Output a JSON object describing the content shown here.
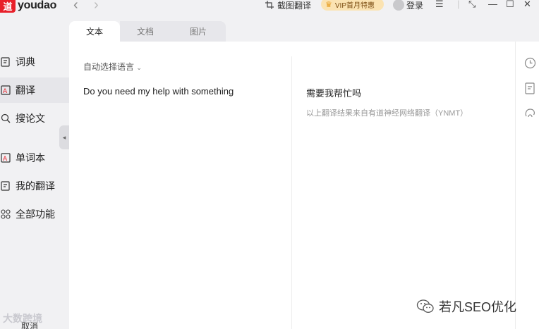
{
  "app": {
    "logo_mark": "道",
    "logo_text": "youdao",
    "nav_back": "‹",
    "nav_forward": "›",
    "screenshot_translate": "截图翻译",
    "vip_promo": "VIP首月特惠",
    "login": "登录",
    "menu": "☰",
    "shrink": "⤡",
    "minimize": "—",
    "maximize": "☐",
    "close": "✕"
  },
  "sidebar": {
    "items": [
      {
        "label": "词典",
        "icon": "dictionary-icon"
      },
      {
        "label": "翻译",
        "icon": "translate-icon"
      },
      {
        "label": "搜论文",
        "icon": "paper-search-icon"
      },
      {
        "label": "单词本",
        "icon": "wordbook-icon"
      },
      {
        "label": "我的翻译",
        "icon": "my-translation-icon"
      },
      {
        "label": "全部功能",
        "icon": "all-features-icon"
      }
    ],
    "collapse": "◂",
    "cancel": "取消"
  },
  "tabs": [
    {
      "label": "文本"
    },
    {
      "label": "文档"
    },
    {
      "label": "图片"
    }
  ],
  "translate": {
    "language_select": "自动选择语言",
    "source_text": "Do you need my help with something",
    "output_text": "需要我帮忙吗",
    "engine_note": "以上翻译结果来自有道神经网络翻译（YNMT）"
  },
  "watermarks": {
    "left": "大数跨境",
    "right": "若凡SEO优化"
  },
  "colors": {
    "brand": "#e8202a",
    "vip_bg": "#fbe3b2",
    "background": "#f1f1f3"
  }
}
